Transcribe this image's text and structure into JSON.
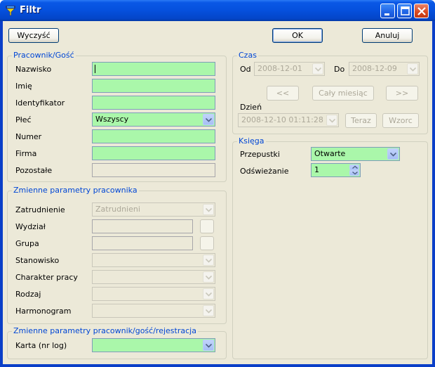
{
  "window": {
    "title": "Filtr"
  },
  "toolbar": {
    "clear_label": "Wyczyść",
    "ok_label": "OK",
    "cancel_label": "Anuluj"
  },
  "employee": {
    "title": "Pracownik/Gość",
    "surname_label": "Nazwisko",
    "surname_value": "",
    "firstname_label": "Imię",
    "firstname_value": "",
    "id_label": "Identyfikator",
    "id_value": "",
    "sex_label": "Płeć",
    "sex_value": "Wszyscy",
    "number_label": "Numer",
    "number_value": "",
    "company_label": "Firma",
    "company_value": "",
    "other_label": "Pozostałe",
    "other_value": ""
  },
  "variable": {
    "title": "Zmienne parametry pracownika",
    "employment_label": "Zatrudnienie",
    "employment_value": "Zatrudnieni",
    "department_label": "Wydział",
    "department_value": "",
    "group_label": "Grupa",
    "group_value": "",
    "position_label": "Stanowisko",
    "position_value": "",
    "worktype_label": "Charakter pracy",
    "worktype_value": "",
    "kind_label": "Rodzaj",
    "kind_value": "",
    "schedule_label": "Harmonogram",
    "schedule_value": ""
  },
  "registration": {
    "title": "Zmienne parametry pracownik/gość/rejestracja",
    "card_label": "Karta (nr log)",
    "card_value": ""
  },
  "time": {
    "title": "Czas",
    "from_label": "Od",
    "from_value": "2008-12-01",
    "to_label": "Do",
    "to_value": "2008-12-09",
    "prev_label": "<<",
    "month_label": "Cały miesiąc",
    "next_label": ">>",
    "day_label": "Dzień",
    "day_value": "2008-12-10 01:11:28",
    "now_label": "Teraz",
    "pattern_label": "Wzorc"
  },
  "book": {
    "title": "Księga",
    "passes_label": "Przepustki",
    "passes_value": "Otwarte",
    "refresh_label": "Odświeżanie",
    "refresh_value": "1"
  },
  "colors": {
    "field_green": "#aaf7aa",
    "group_title": "#0046d5",
    "face": "#ece9d8"
  }
}
